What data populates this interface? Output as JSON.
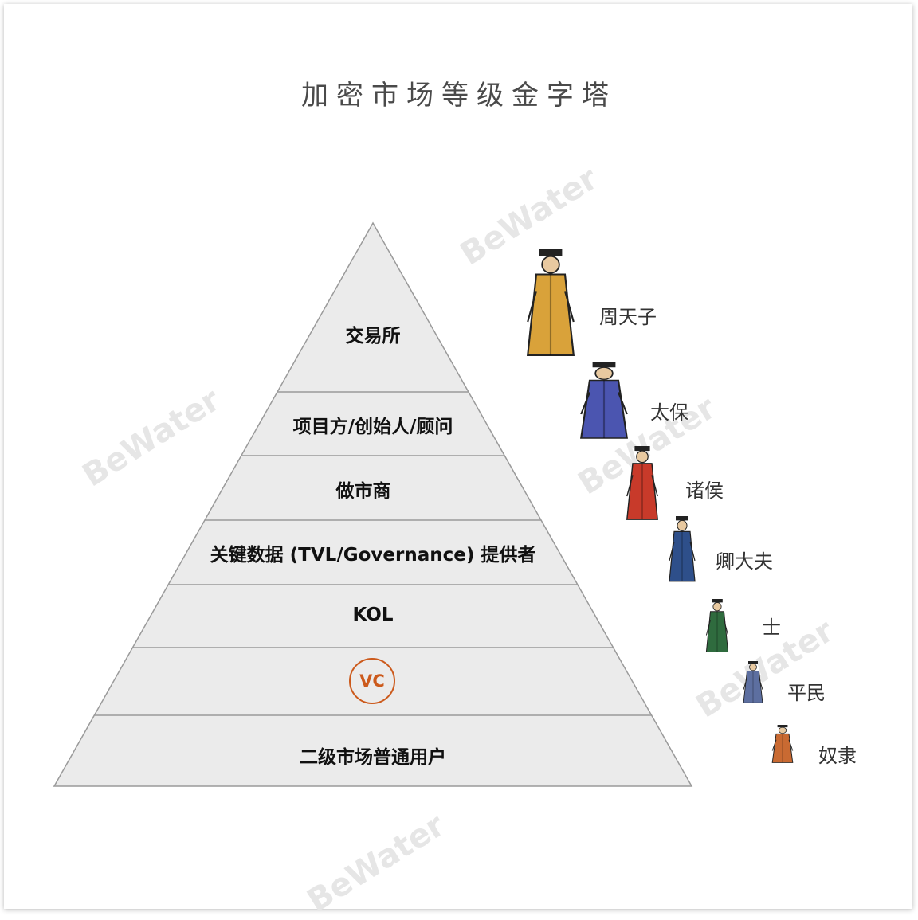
{
  "title": "加密市场等级金字塔",
  "pyramid": {
    "tiers": [
      {
        "label": "交易所",
        "highlight": false
      },
      {
        "label": "项目方/创始人/顾问",
        "highlight": false
      },
      {
        "label": "做市商",
        "highlight": false
      },
      {
        "label": "关键数据 (TVL/Governance) 提供者",
        "highlight": false
      },
      {
        "label": "KOL",
        "highlight": false
      },
      {
        "label": "VC",
        "highlight": true,
        "highlight_color": "#cc5a1c"
      },
      {
        "label": "二级市场普通用户",
        "highlight": false
      }
    ],
    "fill_color": "#ebebeb",
    "line_color": "#9a9a9a"
  },
  "ranks": [
    {
      "label": "周天子",
      "figure": "emperor-figure",
      "color": "#d9a23a"
    },
    {
      "label": "太保",
      "figure": "grand-guardian-figure",
      "color": "#4b55b0"
    },
    {
      "label": "诸侯",
      "figure": "vassal-lord-figure",
      "color": "#c83a2a"
    },
    {
      "label": "卿大夫",
      "figure": "minister-figure",
      "color": "#2e4f8a"
    },
    {
      "label": "士",
      "figure": "scholar-figure",
      "color": "#2f6b3e"
    },
    {
      "label": "平民",
      "figure": "commoner-figure",
      "color": "#5d6fa0"
    },
    {
      "label": "奴隶",
      "figure": "slave-figure",
      "color": "#c96a32"
    }
  ],
  "watermark": {
    "text": "BeWater"
  }
}
